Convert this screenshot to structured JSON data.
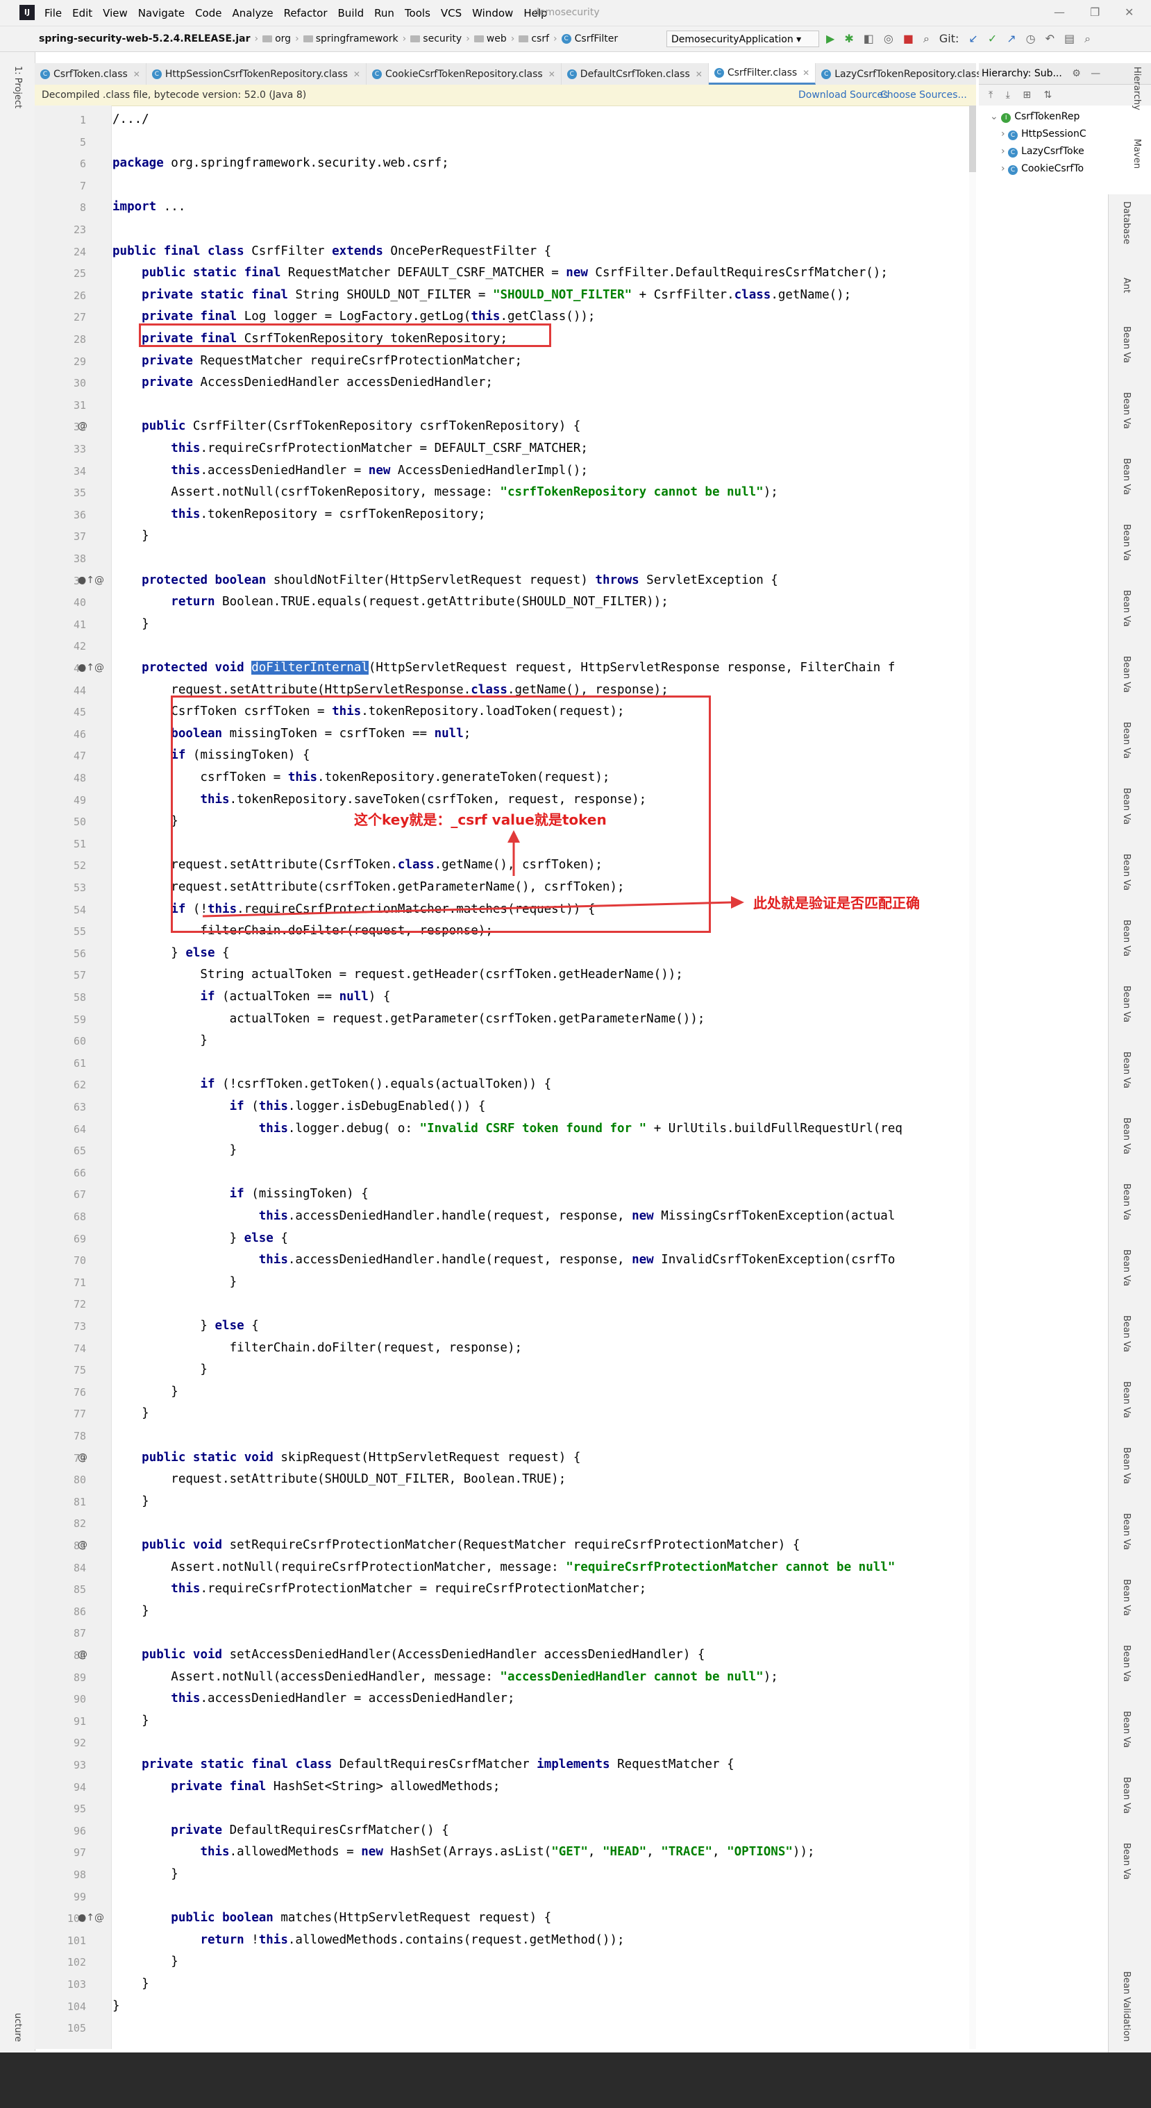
{
  "menu": [
    "File",
    "Edit",
    "View",
    "Navigate",
    "Code",
    "Analyze",
    "Refactor",
    "Build",
    "Run",
    "Tools",
    "VCS",
    "Window",
    "Help"
  ],
  "window_title": "demosecurity",
  "nav": {
    "jar": "spring-security-web-5.2.4.RELEASE.jar",
    "path": [
      "org",
      "springframework",
      "security",
      "web",
      "csrf"
    ],
    "cls": "CsrfFilter",
    "run_config": "DemosecurityApplication",
    "git_label": "Git:"
  },
  "tabs": [
    "CsrfToken.class",
    "HttpSessionCsrfTokenRepository.class",
    "CookieCsrfTokenRepository.class",
    "DefaultCsrfToken.class",
    "CsrfFilter.class",
    "LazyCsrfTokenRepository.class"
  ],
  "active_tab": 4,
  "hierarchy": {
    "title": "Hierarchy:",
    "subtitle": "Sub...",
    "nodes": [
      "CsrfTokenRep",
      "HttpSessionC",
      "LazyCsrfToke",
      "CookieCsrfTo"
    ]
  },
  "banner": {
    "message": "Decompiled .class file, bytecode version: 52.0 (Java 8)",
    "download": "Download Sources",
    "choose": "Choose Sources..."
  },
  "left_labels": [
    "1: Project"
  ],
  "right_labels": [
    "Hierarchy",
    "Maven",
    "Database",
    "Ant",
    "Bean Va",
    "Bean Validation"
  ],
  "structure_label": "ucture",
  "line_numbers": [
    "1",
    "5",
    "6",
    "7",
    "8",
    "23",
    "24",
    "25",
    "26",
    "27",
    "28",
    "29",
    "30",
    "31",
    "32",
    "33",
    "34",
    "35",
    "36",
    "37",
    "38",
    "39",
    "40",
    "41",
    "42",
    "43",
    "44",
    "45",
    "46",
    "47",
    "48",
    "49",
    "50",
    "51",
    "52",
    "53",
    "54",
    "55",
    "56",
    "57",
    "58",
    "59",
    "60",
    "61",
    "62",
    "63",
    "64",
    "65",
    "66",
    "67",
    "68",
    "69",
    "70",
    "71",
    "72",
    "73",
    "74",
    "75",
    "76",
    "77",
    "78",
    "79",
    "80",
    "81",
    "82",
    "83",
    "84",
    "85",
    "86",
    "87",
    "88",
    "89",
    "90",
    "91",
    "92",
    "93",
    "94",
    "95",
    "96",
    "97",
    "98",
    "99",
    "100",
    "101",
    "102",
    "103",
    "104",
    "105"
  ],
  "code": [
    "/.../",
    "",
    "package org.springframework.security.web.csrf;",
    "",
    "import ...",
    "",
    "public final class CsrfFilter extends OncePerRequestFilter {",
    "    public static final RequestMatcher DEFAULT_CSRF_MATCHER = new CsrfFilter.DefaultRequiresCsrfMatcher();",
    "    private static final String SHOULD_NOT_FILTER = \"SHOULD_NOT_FILTER\" + CsrfFilter.class.getName();",
    "    private final Log logger = LogFactory.getLog(this.getClass());",
    "    private final CsrfTokenRepository tokenRepository;",
    "    private RequestMatcher requireCsrfProtectionMatcher;",
    "    private AccessDeniedHandler accessDeniedHandler;",
    "",
    "    public CsrfFilter(CsrfTokenRepository csrfTokenRepository) {",
    "        this.requireCsrfProtectionMatcher = DEFAULT_CSRF_MATCHER;",
    "        this.accessDeniedHandler = new AccessDeniedHandlerImpl();",
    "        Assert.notNull(csrfTokenRepository, message: \"csrfTokenRepository cannot be null\");",
    "        this.tokenRepository = csrfTokenRepository;",
    "    }",
    "",
    "    protected boolean shouldNotFilter(HttpServletRequest request) throws ServletException {",
    "        return Boolean.TRUE.equals(request.getAttribute(SHOULD_NOT_FILTER));",
    "    }",
    "",
    "    protected void doFilterInternal(HttpServletRequest request, HttpServletResponse response, FilterChain f",
    "        request.setAttribute(HttpServletResponse.class.getName(), response);",
    "        CsrfToken csrfToken = this.tokenRepository.loadToken(request);",
    "        boolean missingToken = csrfToken == null;",
    "        if (missingToken) {",
    "            csrfToken = this.tokenRepository.generateToken(request);",
    "            this.tokenRepository.saveToken(csrfToken, request, response);",
    "        }",
    "",
    "        request.setAttribute(CsrfToken.class.getName(), csrfToken);",
    "        request.setAttribute(csrfToken.getParameterName(), csrfToken);",
    "        if (!this.requireCsrfProtectionMatcher.matches(request)) {",
    "            filterChain.doFilter(request, response);",
    "        } else {",
    "            String actualToken = request.getHeader(csrfToken.getHeaderName());",
    "            if (actualToken == null) {",
    "                actualToken = request.getParameter(csrfToken.getParameterName());",
    "            }",
    "",
    "            if (!csrfToken.getToken().equals(actualToken)) {",
    "                if (this.logger.isDebugEnabled()) {",
    "                    this.logger.debug( o: \"Invalid CSRF token found for \" + UrlUtils.buildFullRequestUrl(req",
    "                }",
    "",
    "                if (missingToken) {",
    "                    this.accessDeniedHandler.handle(request, response, new MissingCsrfTokenException(actual",
    "                } else {",
    "                    this.accessDeniedHandler.handle(request, response, new InvalidCsrfTokenException(csrfTo",
    "                }",
    "",
    "            } else {",
    "                filterChain.doFilter(request, response);",
    "            }",
    "        }",
    "    }",
    "",
    "    public static void skipRequest(HttpServletRequest request) {",
    "        request.setAttribute(SHOULD_NOT_FILTER, Boolean.TRUE);",
    "    }",
    "",
    "    public void setRequireCsrfProtectionMatcher(RequestMatcher requireCsrfProtectionMatcher) {",
    "        Assert.notNull(requireCsrfProtectionMatcher, message: \"requireCsrfProtectionMatcher cannot be null\"",
    "        this.requireCsrfProtectionMatcher = requireCsrfProtectionMatcher;",
    "    }",
    "",
    "    public void setAccessDeniedHandler(AccessDeniedHandler accessDeniedHandler) {",
    "        Assert.notNull(accessDeniedHandler, message: \"accessDeniedHandler cannot be null\");",
    "        this.accessDeniedHandler = accessDeniedHandler;",
    "    }",
    "",
    "    private static final class DefaultRequiresCsrfMatcher implements RequestMatcher {",
    "        private final HashSet<String> allowedMethods;",
    "",
    "        private DefaultRequiresCsrfMatcher() {",
    "            this.allowedMethods = new HashSet(Arrays.asList(\"GET\", \"HEAD\", \"TRACE\", \"OPTIONS\"));",
    "        }",
    "",
    "        public boolean matches(HttpServletRequest request) {",
    "            return !this.allowedMethods.contains(request.getMethod());",
    "        }",
    "    }",
    "}",
    ""
  ],
  "gutter_marks": {
    "32": "@",
    "39": "●↑@",
    "43": "●↑@",
    "79": "@",
    "83": "@",
    "88": "@",
    "100": "●↑@"
  },
  "annotations": {
    "key_note": "这个key就是：_csrf  value就是token",
    "match_note": "此处就是验证是否匹配正确"
  },
  "accent_color": "#e13a3a"
}
